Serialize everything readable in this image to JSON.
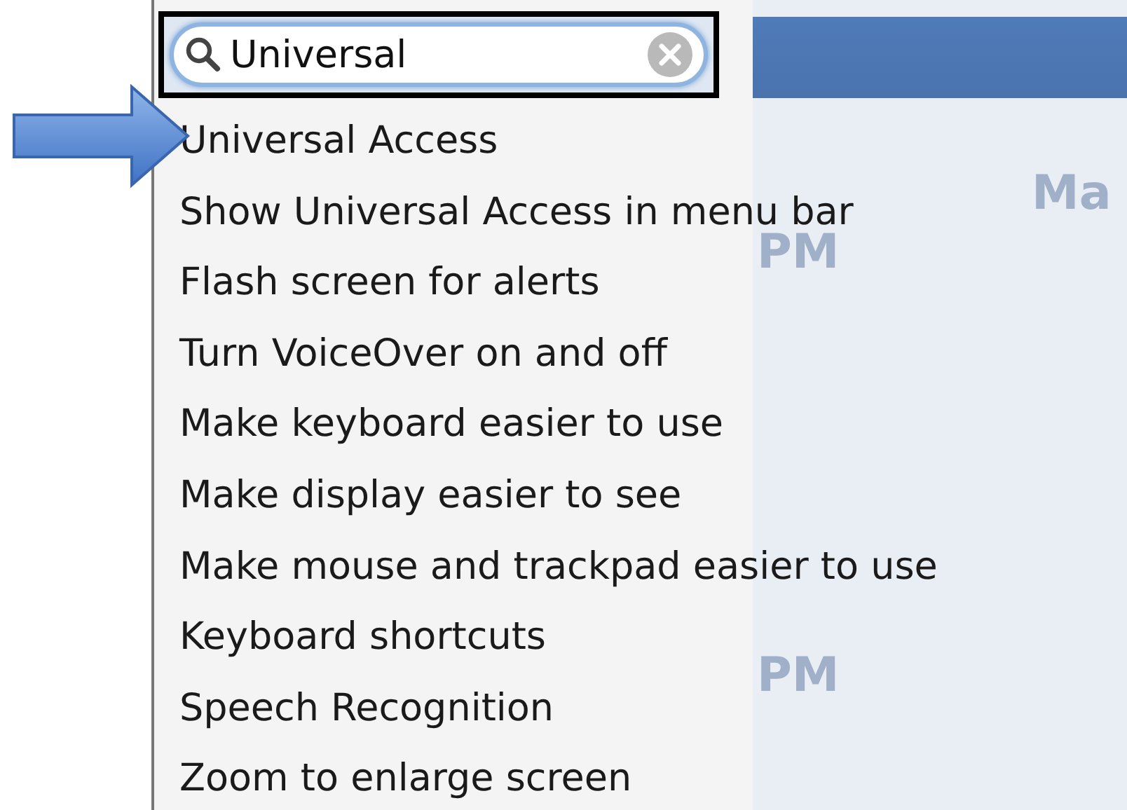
{
  "search": {
    "value": "Universal"
  },
  "results": [
    {
      "label": "Universal Access"
    },
    {
      "label": "Show Universal Access in menu bar"
    },
    {
      "label": "Flash screen for alerts"
    },
    {
      "label": "Turn VoiceOver on and off"
    },
    {
      "label": "Make keyboard easier to use"
    },
    {
      "label": "Make display easier to see"
    },
    {
      "label": "Make mouse and trackpad easier to use"
    },
    {
      "label": "Keyboard shortcuts"
    },
    {
      "label": "Speech Recognition"
    },
    {
      "label": "Zoom to enlarge screen"
    }
  ],
  "background_texts": [
    "Ma",
    "PM",
    "PM"
  ]
}
